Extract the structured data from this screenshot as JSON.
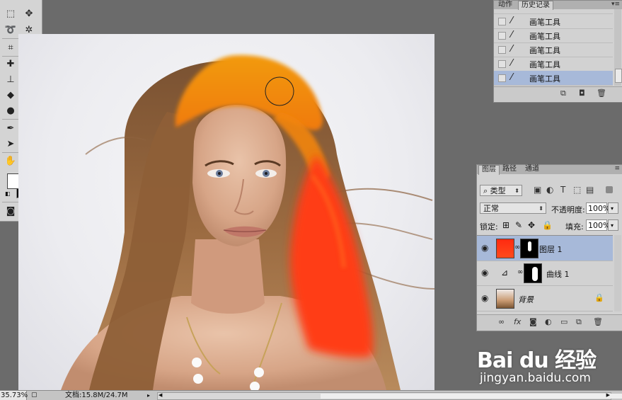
{
  "history_panel": {
    "tabs": [
      "动作",
      "历史记录"
    ],
    "rows": [
      "画笔工具",
      "画笔工具",
      "画笔工具",
      "画笔工具",
      "画笔工具"
    ],
    "selected_index": 4
  },
  "layers_panel": {
    "tabs": [
      "图层",
      "路径",
      "通道"
    ],
    "filter_label": "类型",
    "blend_mode": "正常",
    "opacity_label": "不透明度:",
    "opacity_value": "100%",
    "lock_label": "锁定:",
    "fill_label": "填充:",
    "fill_value": "100%",
    "layers": [
      {
        "name": "图层 1",
        "selected": true
      },
      {
        "name": "曲线 1",
        "selected": false
      },
      {
        "name": "背景",
        "selected": false
      }
    ]
  },
  "status_bar": {
    "zoom": "35.73%",
    "doc_info": "文档:15.8M/24.7M"
  },
  "watermark": {
    "logo": "Bai du 经验",
    "url": "jingyan.baidu.com"
  },
  "colors": {
    "foreground": "#ffffff",
    "background": "#000000",
    "selection": "#a7b9d9",
    "hair_orange": "#f08a0c",
    "hair_red": "#ff3b12"
  }
}
